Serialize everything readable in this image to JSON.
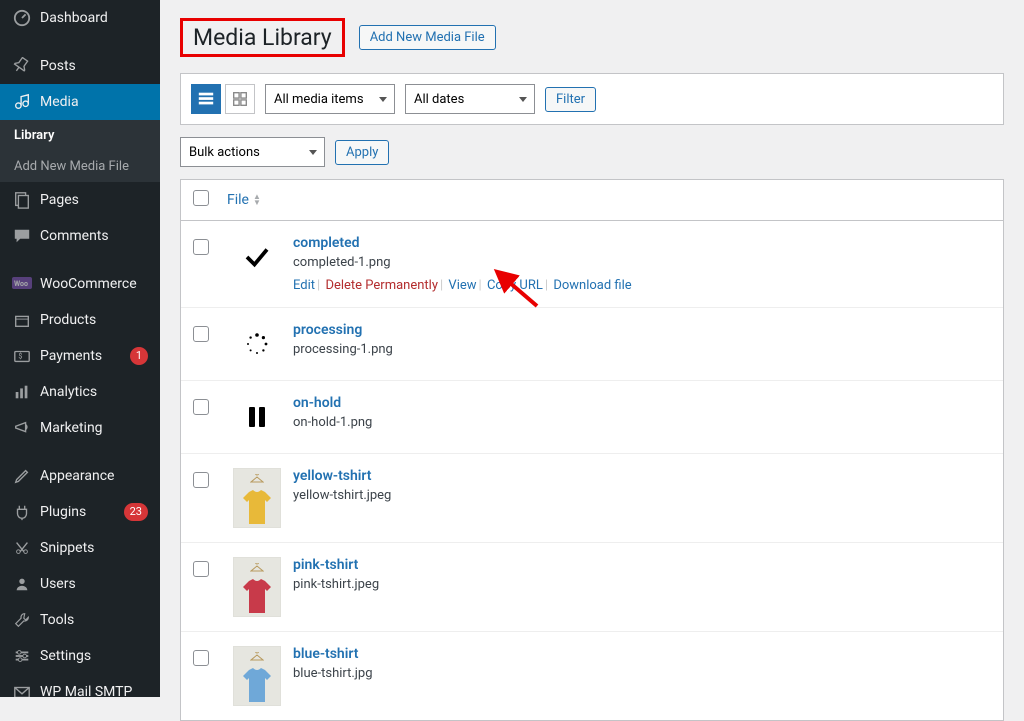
{
  "sidebar": {
    "items": [
      {
        "label": "Dashboard",
        "icon": "dashboard-icon"
      },
      {
        "label": "Posts",
        "icon": "pin-icon"
      },
      {
        "label": "Media",
        "icon": "media-icon",
        "active": true
      },
      {
        "label": "Pages",
        "icon": "page-icon"
      },
      {
        "label": "Comments",
        "icon": "comment-icon"
      },
      {
        "label": "WooCommerce",
        "icon": "woo-icon"
      },
      {
        "label": "Products",
        "icon": "product-icon"
      },
      {
        "label": "Payments",
        "icon": "payment-icon",
        "badge": "1"
      },
      {
        "label": "Analytics",
        "icon": "analytics-icon"
      },
      {
        "label": "Marketing",
        "icon": "marketing-icon"
      },
      {
        "label": "Appearance",
        "icon": "appearance-icon"
      },
      {
        "label": "Plugins",
        "icon": "plugin-icon",
        "badge": "23"
      },
      {
        "label": "Snippets",
        "icon": "snippet-icon"
      },
      {
        "label": "Users",
        "icon": "user-icon"
      },
      {
        "label": "Tools",
        "icon": "tool-icon"
      },
      {
        "label": "Settings",
        "icon": "settings-icon"
      },
      {
        "label": "WP Mail SMTP",
        "icon": "mail-icon"
      }
    ],
    "submenu": [
      {
        "label": "Library",
        "active": true
      },
      {
        "label": "Add New Media File",
        "active": false
      }
    ]
  },
  "header": {
    "title": "Media Library",
    "add_button": "Add New Media File"
  },
  "toolbar": {
    "media_filter": "All media items",
    "date_filter": "All dates",
    "filter_button": "Filter"
  },
  "bulk": {
    "select": "Bulk actions",
    "apply": "Apply"
  },
  "table": {
    "file_header": "File",
    "rows": [
      {
        "title": "completed",
        "filename": "completed-1.png",
        "thumb": "check",
        "actions": true
      },
      {
        "title": "processing",
        "filename": "processing-1.png",
        "thumb": "spinner"
      },
      {
        "title": "on-hold",
        "filename": "on-hold-1.png",
        "thumb": "pause"
      },
      {
        "title": "yellow-tshirt",
        "filename": "yellow-tshirt.jpeg",
        "thumb": "yellow-shirt"
      },
      {
        "title": "pink-tshirt",
        "filename": "pink-tshirt.jpeg",
        "thumb": "pink-shirt"
      },
      {
        "title": "blue-tshirt",
        "filename": "blue-tshirt.jpg",
        "thumb": "blue-shirt"
      }
    ],
    "actions": {
      "edit": "Edit",
      "delete": "Delete Permanently",
      "view": "View",
      "copy": "Copy URL",
      "download": "Download file"
    }
  },
  "colors": {
    "yellow": "#e8b939",
    "pink": "#c83a4a",
    "blue": "#6fa8d8",
    "hanger": "#b89a5e"
  }
}
